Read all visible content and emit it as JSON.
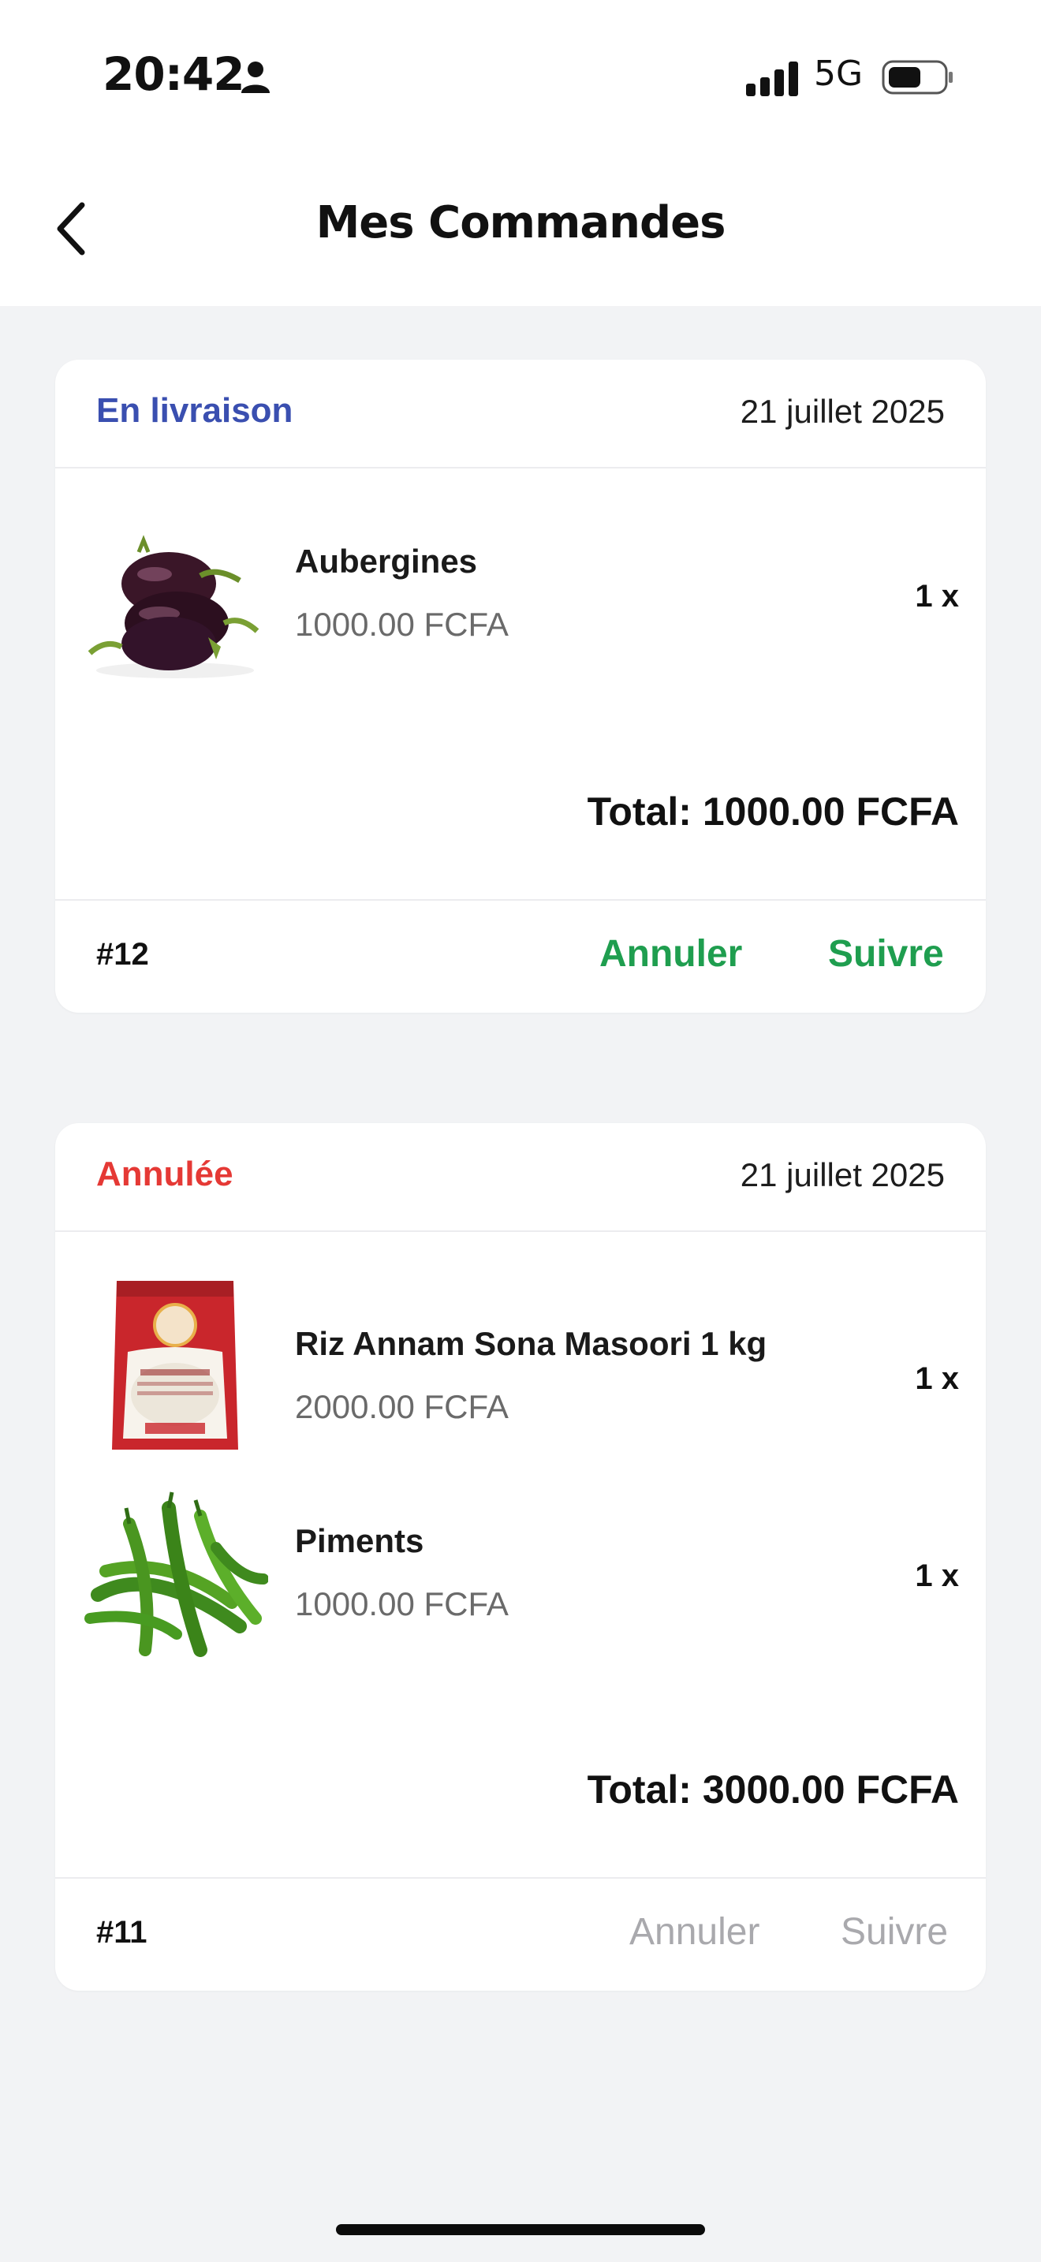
{
  "status_bar": {
    "time": "20:42",
    "network": "5G"
  },
  "header": {
    "title": "Mes Commandes"
  },
  "colors": {
    "delivery": "#3a4fb0",
    "cancelled": "#e53935",
    "action": "#1f9e4f",
    "disabled": "#a9a9ad"
  },
  "orders": [
    {
      "status": "En livraison",
      "date": "21 juillet 2025",
      "items": [
        {
          "name": "Aubergines",
          "price": "1000.00 FCFA",
          "qty": "1 x",
          "image": "eggplant-image"
        }
      ],
      "total": "Total: 1000.00 FCFA",
      "id": "#12",
      "cancel_label": "Annuler",
      "track_label": "Suivre",
      "actions_enabled": true
    },
    {
      "status": "Annulée",
      "date": "21 juillet 2025",
      "items": [
        {
          "name": "Riz Annam Sona Masoori 1 kg",
          "price": "2000.00 FCFA",
          "qty": "1 x",
          "image": "rice-bag-image"
        },
        {
          "name": "Piments",
          "price": "1000.00 FCFA",
          "qty": "1 x",
          "image": "chili-peppers-image"
        }
      ],
      "total": "Total: 3000.00 FCFA",
      "id": "#11",
      "cancel_label": "Annuler",
      "track_label": "Suivre",
      "actions_enabled": false
    }
  ]
}
